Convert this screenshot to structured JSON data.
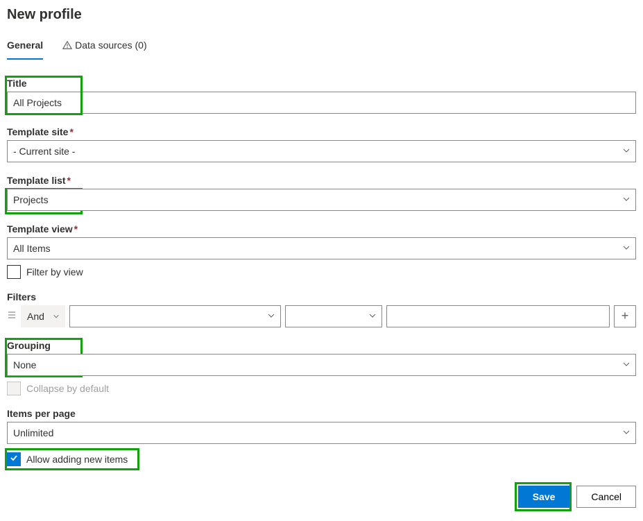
{
  "header": {
    "title": "New profile"
  },
  "tabs": {
    "general": "General",
    "dataSources": "Data sources (0)"
  },
  "fields": {
    "title": {
      "label": "Title",
      "value": "All Projects"
    },
    "templateSite": {
      "label": "Template site",
      "value": "- Current site -"
    },
    "templateList": {
      "label": "Template list",
      "value": "Projects"
    },
    "templateView": {
      "label": "Template view",
      "value": "All Items"
    },
    "filterByView": {
      "label": "Filter by view"
    },
    "filters": {
      "label": "Filters",
      "logic": "And"
    },
    "grouping": {
      "label": "Grouping",
      "value": "None"
    },
    "collapse": {
      "label": "Collapse by default"
    },
    "itemsPerPage": {
      "label": "Items per page",
      "value": "Unlimited"
    },
    "allowAdd": {
      "label": "Allow adding new items"
    }
  },
  "buttons": {
    "save": "Save",
    "cancel": "Cancel"
  }
}
